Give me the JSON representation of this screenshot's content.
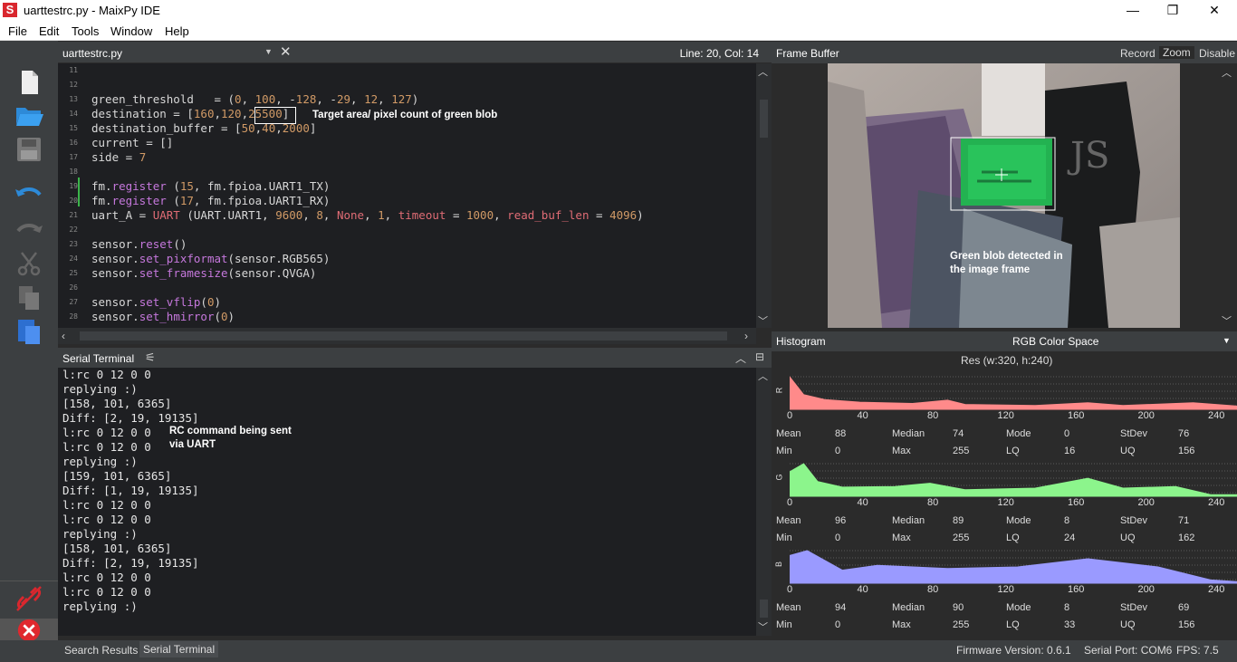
{
  "window": {
    "title": "uarttestrc.py - MaixPy IDE",
    "minimize": "—",
    "maximize": "❐",
    "close": "✕"
  },
  "menu": [
    "File",
    "Edit",
    "Tools",
    "Window",
    "Help"
  ],
  "editor": {
    "filename": "uarttestrc.py",
    "cursor": "Line: 20, Col: 14",
    "lines": [
      {
        "n": "11",
        "text": ""
      },
      {
        "n": "12",
        "text": ""
      },
      {
        "n": "13",
        "text": "green_threshold   = (0, 100, -128, -29, 12, 127)"
      },
      {
        "n": "14",
        "text": "destination = [160,120,25500]"
      },
      {
        "n": "15",
        "text": "destination_buffer = [50,40,2000]"
      },
      {
        "n": "16",
        "text": "current = []"
      },
      {
        "n": "17",
        "text": "side = 7"
      },
      {
        "n": "18",
        "text": ""
      },
      {
        "n": "19",
        "text": "fm.register (15, fm.fpioa.UART1_TX)"
      },
      {
        "n": "20",
        "text": "fm.register (17, fm.fpioa.UART1_RX)"
      },
      {
        "n": "21",
        "text": "uart_A = UART (UART.UART1, 9600, 8, None, 1, timeout = 1000, read_buf_len = 4096)"
      },
      {
        "n": "22",
        "text": ""
      },
      {
        "n": "23",
        "text": "sensor.reset()"
      },
      {
        "n": "24",
        "text": "sensor.set_pixformat(sensor.RGB565)"
      },
      {
        "n": "25",
        "text": "sensor.set_framesize(sensor.QVGA)"
      },
      {
        "n": "26",
        "text": ""
      },
      {
        "n": "27",
        "text": "sensor.set_vflip(0)"
      },
      {
        "n": "28",
        "text": "sensor.set_hmirror(0)"
      }
    ],
    "annotation": "Target area/ pixel count of green blob"
  },
  "serial": {
    "title": "Serial Terminal",
    "lines": [
      "l:rc 0 12 0 0",
      "replying :)",
      "[158, 101, 6365]",
      "Diff: [2, 19, 19135]",
      "l:rc 0 12 0 0",
      "l:rc 0 12 0 0",
      "replying :)",
      "[159, 101, 6365]",
      "Diff: [1, 19, 19135]",
      "l:rc 0 12 0 0",
      "l:rc 0 12 0 0",
      "replying :)",
      "[158, 101, 6365]",
      "Diff: [2, 19, 19135]",
      "l:rc 0 12 0 0",
      "l:rc 0 12 0 0",
      "replying :)"
    ],
    "annotation1": "RC command being sent",
    "annotation2": "via UART"
  },
  "framebuffer": {
    "title": "Frame Buffer",
    "record": "Record",
    "zoom": "Zoom",
    "disable": "Disable",
    "annotation1": "Green blob detected in",
    "annotation2": "the image frame"
  },
  "histogram": {
    "title": "Histogram",
    "colorspace": "RGB Color Space",
    "res": "Res (w:320, h:240)",
    "ticks": [
      "0",
      "40",
      "80",
      "120",
      "160",
      "200",
      "240"
    ],
    "channels": [
      {
        "label": "R",
        "color": "#ff8a8a",
        "stats": {
          "Mean": "88",
          "Median": "74",
          "Mode": "0",
          "StDev": "76",
          "Min": "0",
          "Max": "255",
          "LQ": "16",
          "UQ": "156"
        }
      },
      {
        "label": "G",
        "color": "#8cf58c",
        "stats": {
          "Mean": "96",
          "Median": "89",
          "Mode": "8",
          "StDev": "71",
          "Min": "0",
          "Max": "255",
          "LQ": "24",
          "UQ": "162"
        }
      },
      {
        "label": "B",
        "color": "#9a9aff",
        "stats": {
          "Mean": "94",
          "Median": "90",
          "Mode": "8",
          "StDev": "69",
          "Min": "0",
          "Max": "255",
          "LQ": "33",
          "UQ": "156"
        }
      }
    ]
  },
  "status": {
    "tab_search": "Search Results",
    "tab_serial": "Serial Terminal",
    "firmware": "Firmware Version: 0.6.1",
    "port": "Serial Port: COM6",
    "fps": "FPS:  7.5"
  }
}
